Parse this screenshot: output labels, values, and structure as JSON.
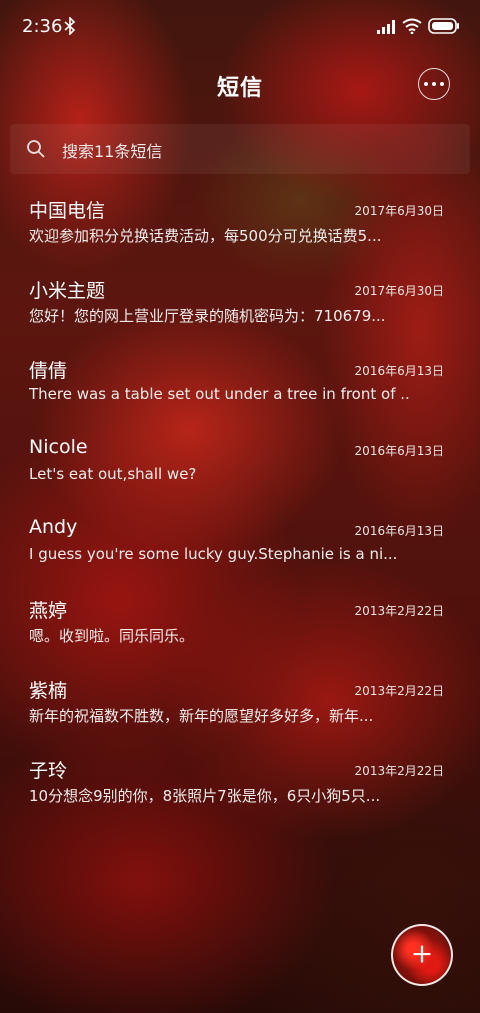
{
  "status": {
    "time": "2:36"
  },
  "header": {
    "title": "短信"
  },
  "search": {
    "placeholder": "搜索11条短信"
  },
  "messages": [
    {
      "name": "中国电信",
      "date": "2017年6月30日",
      "preview": "欢迎参加积分兑换话费活动，每500分可兑换话费5..."
    },
    {
      "name": "小米主题",
      "date": "2017年6月30日",
      "preview": "您好！您的网上营业厅登录的随机密码为：710679..."
    },
    {
      "name": "倩倩",
      "date": "2016年6月13日",
      "preview": "There was a table set out under a tree in front of ..."
    },
    {
      "name": "Nicole",
      "date": "2016年6月13日",
      "preview": "Let's eat out,shall we?"
    },
    {
      "name": "Andy",
      "date": "2016年6月13日",
      "preview": "I guess you're some lucky guy.Stephanie is a ni..."
    },
    {
      "name": "燕婷",
      "date": "2013年2月22日",
      "preview": "嗯。收到啦。同乐同乐。"
    },
    {
      "name": "紫楠",
      "date": "2013年2月22日",
      "preview": "新年的祝福数不胜数，新年的愿望好多好多，新年..."
    },
    {
      "name": "子玲",
      "date": "2013年2月22日",
      "preview": "10分想念9别的你，8张照片7张是你，6只小狗5只..."
    }
  ],
  "icons": {
    "bluetooth": "bluetooth-icon",
    "signal": "signal-icon",
    "wifi": "wifi-icon",
    "battery": "battery-icon",
    "more": "more-icon",
    "search": "search-icon",
    "compose": "compose-icon"
  },
  "colors": {
    "text": "#ffffff",
    "accent_red": "#d8261a"
  }
}
